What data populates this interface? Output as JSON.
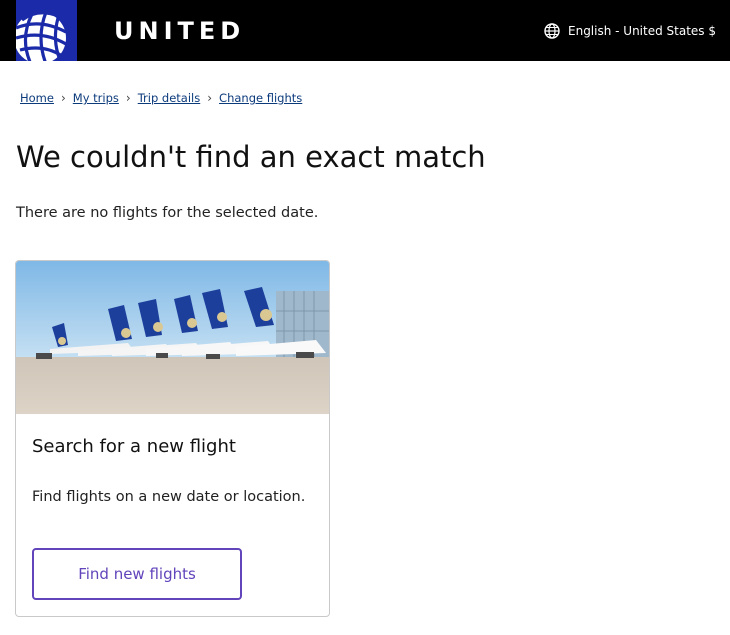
{
  "header": {
    "brand": "UNITED",
    "language_label": "English - United States $"
  },
  "breadcrumb": [
    "Home",
    "My trips",
    "Trip details",
    "Change flights"
  ],
  "page": {
    "title": "We couldn't find an exact match",
    "subtitle": "There are no flights for the selected date."
  },
  "card": {
    "title": "Search for a new flight",
    "text": "Find flights on a new date or location.",
    "button_label": "Find new flights"
  },
  "colors": {
    "header_bg": "#000000",
    "logo_bg": "#1a2aa8",
    "link": "#0c3b7c",
    "button_accent": "#6244bb"
  },
  "icons": {
    "logo": "united-globe-logo-icon",
    "language": "globe-icon",
    "breadcrumb_separator": "chevron-right-icon"
  }
}
